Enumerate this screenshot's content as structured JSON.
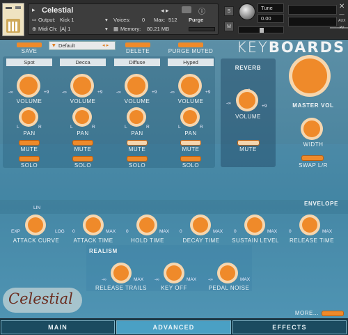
{
  "header": {
    "title": "Celestial",
    "output_label": "Output:",
    "output_value": "Kick 1",
    "voices_label": "Voices:",
    "voices_value": "0",
    "max_label": "Max:",
    "max_value": "512",
    "purge_label": "Purge",
    "midi_label": "Midi Ch:",
    "midi_value": "[A]  1",
    "memory_label": "Memory:",
    "memory_value": "80.21 MB",
    "tune_label": "Tune",
    "tune_value": "0.00",
    "s_label": "S",
    "m_label": "M",
    "aux_label": "AUX",
    "pv_label": "PV"
  },
  "toolbar": {
    "save_label": "SAVE",
    "preset_value": "Default",
    "delete_label": "DELETE",
    "purge_muted_label": "PURGE MUTED",
    "brand_left": "KEY",
    "brand_right": "BOARDS"
  },
  "mics": [
    {
      "name": "Spot",
      "volume_label": "VOLUME",
      "pan_label": "PAN",
      "mute_label": "MUTE",
      "solo_label": "SOLO",
      "mute_on": false
    },
    {
      "name": "Decca",
      "volume_label": "VOLUME",
      "pan_label": "PAN",
      "mute_label": "MUTE",
      "solo_label": "SOLO",
      "mute_on": false
    },
    {
      "name": "Diffuse",
      "volume_label": "VOLUME",
      "pan_label": "PAN",
      "mute_label": "MUTE",
      "solo_label": "SOLO",
      "mute_on": true
    },
    {
      "name": "Hyped",
      "volume_label": "VOLUME",
      "pan_label": "PAN",
      "mute_label": "MUTE",
      "solo_label": "SOLO",
      "mute_on": true
    }
  ],
  "scale": {
    "min": "-∞",
    "zero": "0",
    "plus": "+9",
    "left": "L",
    "right": "R"
  },
  "reverb": {
    "title": "REVERB",
    "volume_label": "VOLUME",
    "mute_label": "MUTE"
  },
  "master": {
    "title": "MASTER VOL",
    "width_label": "WIDTH",
    "swap_label": "SWAP L/R"
  },
  "envelope": {
    "title": "ENVELOPE",
    "attack_curve_label": "ATTACK CURVE",
    "exp_label": "EXP",
    "lin_label": "LIN",
    "log_label": "LOG",
    "knobs": [
      {
        "label": "ATTACK TIME",
        "min": "0",
        "max": "MAX"
      },
      {
        "label": "HOLD TIME",
        "min": "0",
        "max": "MAX"
      },
      {
        "label": "DECAY TIME",
        "min": "0",
        "max": "MAX"
      },
      {
        "label": "SUSTAIN LEVEL",
        "min": "0",
        "max": "MAX"
      },
      {
        "label": "RELEASE TIME",
        "min": "0",
        "max": "MAX"
      }
    ]
  },
  "realism": {
    "title": "REALISM",
    "knobs": [
      {
        "label": "RELEASE TRAILS",
        "min": "-∞",
        "max": "MAX"
      },
      {
        "label": "KEY OFF",
        "min": "-∞",
        "max": "MAX"
      },
      {
        "label": "PEDAL NOISE",
        "min": "-∞",
        "max": "MAX"
      }
    ]
  },
  "footer": {
    "logo_text": "Celestial",
    "more_label": "MORE...",
    "tabs": [
      {
        "label": "MAIN"
      },
      {
        "label": "ADVANCED"
      },
      {
        "label": "EFFECTS"
      }
    ],
    "active_tab": "ADVANCED"
  },
  "colors": {
    "accent": "#ef8a2a",
    "knob_light": "#f6d6ae",
    "panel": "#4d86a0"
  }
}
